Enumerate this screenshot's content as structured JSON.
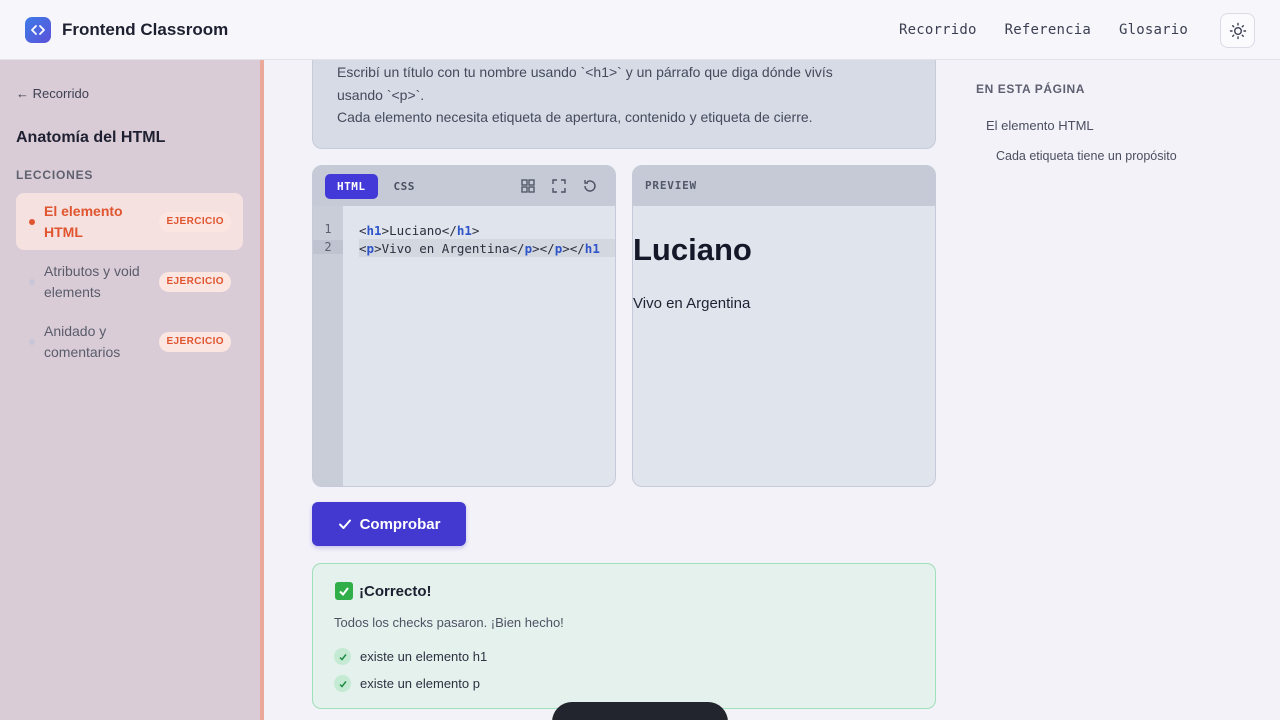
{
  "header": {
    "brand": "Frontend Classroom",
    "nav": [
      "Recorrido",
      "Referencia",
      "Glosario"
    ]
  },
  "sidebar": {
    "back": "← Recorrido",
    "section_title": "Anatomía del HTML",
    "lessons_label": "LECCIONES",
    "lessons": [
      {
        "label": "El elemento HTML",
        "badge": "EJERCICIO",
        "active": true
      },
      {
        "label": "Atributos y void elements",
        "badge": "EJERCICIO",
        "active": false
      },
      {
        "label": "Anidado y comentarios",
        "badge": "EJERCICIO",
        "active": false
      }
    ]
  },
  "instructions": {
    "line1": "Escribí un título con tu nombre usando `<h1>` y un párrafo que diga dónde vivís",
    "line2": "usando `<p>`.",
    "line3": "Cada elemento necesita etiqueta de apertura, contenido y etiqueta de cierre."
  },
  "editor": {
    "tabs": [
      "HTML",
      "CSS"
    ],
    "line_numbers": [
      "1",
      "2"
    ]
  },
  "preview": {
    "label": "PREVIEW",
    "h1": "Luciano",
    "p": "Vivo en Argentina"
  },
  "check_button": "Comprobar",
  "result": {
    "title": "¡Correcto!",
    "message": "Todos los checks pasaron. ¡Bien hecho!",
    "checks": [
      "existe un elemento h1",
      "existe un elemento p"
    ]
  },
  "toc": {
    "label": "EN ESTA PÁGINA",
    "items": [
      "El elemento HTML",
      "Cada etiqueta tiene un propósito"
    ]
  },
  "colors": {
    "accent": "#4338d0",
    "lesson_active": "#e0552f",
    "success_border": "#9ee0b8"
  }
}
